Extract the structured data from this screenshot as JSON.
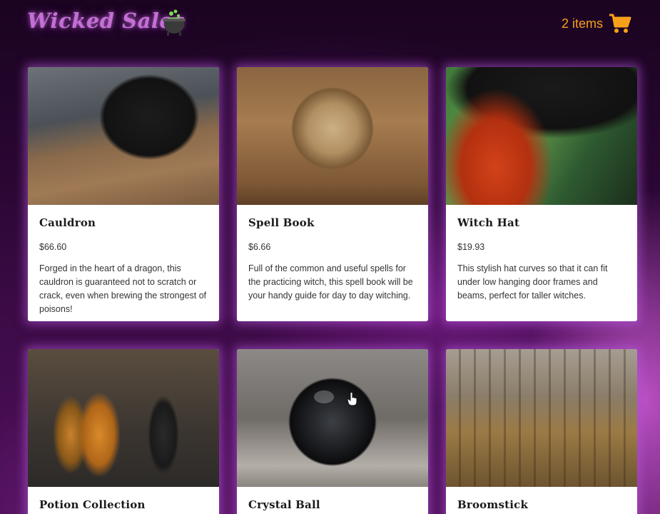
{
  "header": {
    "logo": "Wicked Sales",
    "cart_count": "2 items",
    "icons": {
      "logo_icon": "cauldron-icon",
      "cart_icon": "shopping-cart-icon"
    },
    "colors": {
      "logo": "#c46fd6",
      "cart": "#f7a11a"
    }
  },
  "products": [
    {
      "name": "Cauldron",
      "price": "$66.60",
      "description": "Forged in the heart of a dragon, this cauldron is guaranteed not to scratch or crack, even when brewing the strongest of poisons!"
    },
    {
      "name": "Spell Book",
      "price": "$6.66",
      "description": "Full of the common and useful spells for the practicing witch, this spell book will be your handy guide for day to day witching."
    },
    {
      "name": "Witch Hat",
      "price": "$19.93",
      "description": "This stylish hat curves so that it can fit under low hanging door frames and beams, perfect for taller witches."
    },
    {
      "name": "Potion Collection"
    },
    {
      "name": "Crystal Ball"
    },
    {
      "name": "Broomstick"
    }
  ]
}
